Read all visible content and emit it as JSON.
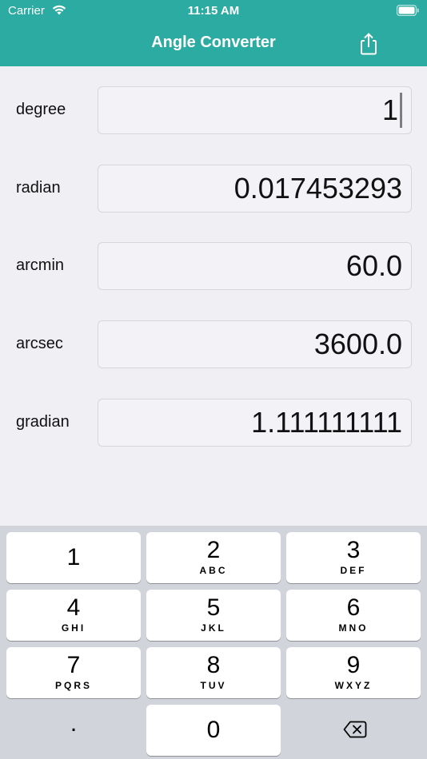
{
  "status_bar": {
    "carrier": "Carrier",
    "time": "11:15 AM"
  },
  "nav": {
    "title": "Angle Converter",
    "share_icon": "share-icon"
  },
  "fields": [
    {
      "label": "degree",
      "value": "1",
      "focused": true
    },
    {
      "label": "radian",
      "value": "0.017453293",
      "focused": false
    },
    {
      "label": "arcmin",
      "value": "60.0",
      "focused": false
    },
    {
      "label": "arcsec",
      "value": "3600.0",
      "focused": false
    },
    {
      "label": "gradian",
      "value": "1.111111111",
      "focused": false
    }
  ],
  "keyboard": {
    "keys": [
      {
        "digit": "1",
        "letters": ""
      },
      {
        "digit": "2",
        "letters": "ABC"
      },
      {
        "digit": "3",
        "letters": "DEF"
      },
      {
        "digit": "4",
        "letters": "GHI"
      },
      {
        "digit": "5",
        "letters": "JKL"
      },
      {
        "digit": "6",
        "letters": "MNO"
      },
      {
        "digit": "7",
        "letters": "PQRS"
      },
      {
        "digit": "8",
        "letters": "TUV"
      },
      {
        "digit": "9",
        "letters": "WXYZ"
      }
    ],
    "dot": ".",
    "zero": "0",
    "delete_icon": "backspace-icon"
  },
  "colors": {
    "accent": "#2BABA1",
    "background": "#EFEFF4",
    "keyboard_bg": "#D1D4DA"
  }
}
